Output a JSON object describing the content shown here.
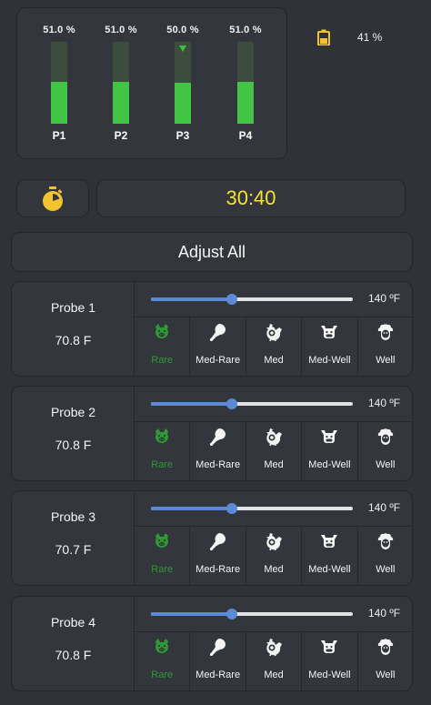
{
  "probes_overview": [
    {
      "name": "P1",
      "percent_text": "51.0 %",
      "level": 0.51,
      "marker": false
    },
    {
      "name": "P2",
      "percent_text": "51.0 %",
      "level": 0.51,
      "marker": false
    },
    {
      "name": "P3",
      "percent_text": "50.0 %",
      "level": 0.5,
      "marker": true
    },
    {
      "name": "P4",
      "percent_text": "51.0 %",
      "level": 0.51,
      "marker": false
    }
  ],
  "battery": {
    "percent_text": "41 %",
    "icon": "battery-icon",
    "color": "#f4c430"
  },
  "timer": {
    "icon": "stopwatch-icon",
    "display": "30:40",
    "color": "#f4e332"
  },
  "adjust_all": {
    "label": "Adjust All"
  },
  "slider_range": {
    "min": 100,
    "max": 200
  },
  "doneness_options": [
    {
      "label": "Rare",
      "icon": "pig-icon"
    },
    {
      "label": "Med-Rare",
      "icon": "drumstick-icon"
    },
    {
      "label": "Med",
      "icon": "chicken-icon"
    },
    {
      "label": "Med-Well",
      "icon": "cow-icon"
    },
    {
      "label": "Well",
      "icon": "sheep-icon"
    }
  ],
  "probes": [
    {
      "title": "Probe 1",
      "temp": "70.8 F",
      "target_value": 140,
      "target_text": "140 ºF",
      "selected": "Rare"
    },
    {
      "title": "Probe 2",
      "temp": "70.8 F",
      "target_value": 140,
      "target_text": "140 ºF",
      "selected": "Rare"
    },
    {
      "title": "Probe 3",
      "temp": "70.7 F",
      "target_value": 140,
      "target_text": "140 ºF",
      "selected": "Rare"
    },
    {
      "title": "Probe 4",
      "temp": "70.8 F",
      "target_value": 140,
      "target_text": "140 ºF",
      "selected": "Rare"
    }
  ],
  "colors": {
    "selected": "#2f9a33",
    "bar": "#42c544",
    "slider": "#5b8bd6"
  }
}
